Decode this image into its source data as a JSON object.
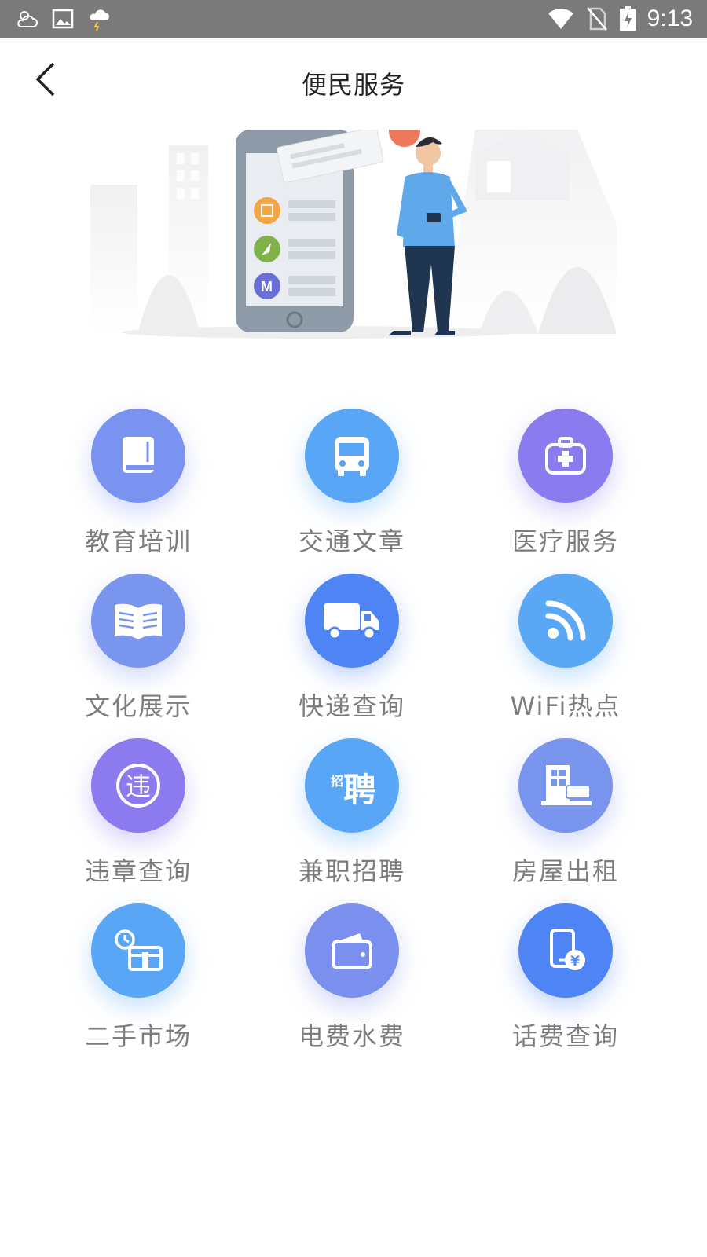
{
  "status_bar": {
    "time": "9:13",
    "left_icons": [
      "cloud-sun-icon",
      "image-icon",
      "thunderstorm-icon"
    ],
    "right_icons": [
      "wifi-icon",
      "no-sim-icon",
      "battery-charging-icon"
    ]
  },
  "header": {
    "title": "便民服务",
    "back_icon": "chevron-left-icon"
  },
  "banner": {
    "illustration": "person-phone-illustration"
  },
  "services": [
    {
      "label": "教育培训",
      "icon": "book-icon",
      "color": "#7b93f0"
    },
    {
      "label": "交通文章",
      "icon": "bus-icon",
      "color": "#5aa6f6"
    },
    {
      "label": "医疗服务",
      "icon": "medical-kit-icon",
      "color": "#8a7bef"
    },
    {
      "label": "文化展示",
      "icon": "open-book-icon",
      "color": "#7a95ee"
    },
    {
      "label": "快递查询",
      "icon": "truck-icon",
      "color": "#4f84f5"
    },
    {
      "label": "WiFi热点",
      "icon": "wifi-signal-icon",
      "color": "#5aa7f6"
    },
    {
      "label": "违章查询",
      "icon": "violation-icon",
      "color": "#8b7bef"
    },
    {
      "label": "兼职招聘",
      "icon": "recruit-icon",
      "color": "#5aa6f6"
    },
    {
      "label": "房屋出租",
      "icon": "house-rent-icon",
      "color": "#7a95ee"
    },
    {
      "label": "二手市场",
      "icon": "market-box-icon",
      "color": "#5aa6f6"
    },
    {
      "label": "电费水费",
      "icon": "wallet-icon",
      "color": "#7a8fee"
    },
    {
      "label": "话费查询",
      "icon": "phone-bill-icon",
      "color": "#4f84f5"
    }
  ],
  "recruit_glyphs": {
    "small": "招",
    "big": "聘"
  },
  "violation_glyph": "违",
  "currency_glyph": "¥"
}
